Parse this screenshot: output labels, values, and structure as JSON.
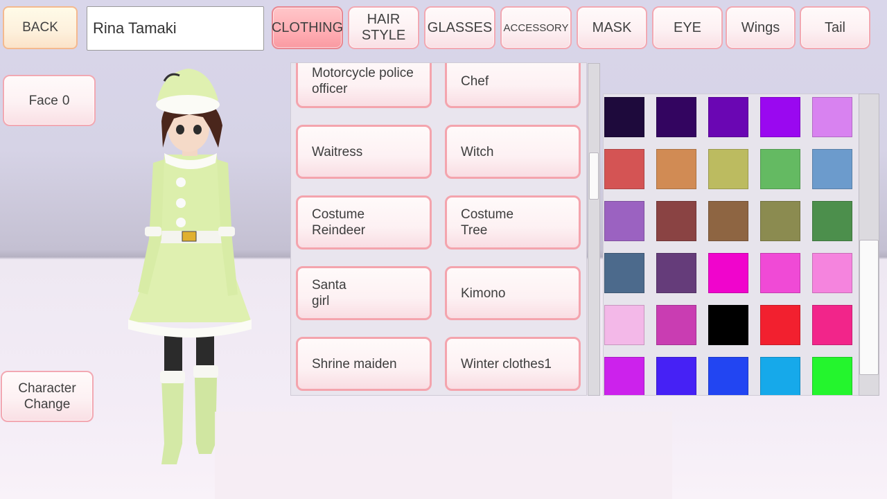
{
  "back_label": "BACK",
  "name_value": "Rina Tamaki",
  "tabs": [
    {
      "label": "CLOTHING",
      "active": true
    },
    {
      "label": "HAIR\nSTYLE",
      "active": false
    },
    {
      "label": "GLASSES",
      "active": false
    },
    {
      "label": "ACCESSORY",
      "active": false
    },
    {
      "label": "MASK",
      "active": false
    },
    {
      "label": "EYE",
      "active": false
    },
    {
      "label": "Wings",
      "active": false
    },
    {
      "label": "Tail",
      "active": false
    }
  ],
  "face_label": "Face",
  "face_value": "0",
  "character_change_label": "Character\nChange",
  "clothing_items": [
    "Motorcycle police\nofficer",
    "Chef",
    "Waitress",
    "Witch",
    "Costume\nReindeer",
    "Costume\nTree",
    "Santa\ngirl",
    "Kimono",
    "Shrine maiden",
    "Winter clothes1"
  ],
  "colors": [
    "#1e0a3c",
    "#330560",
    "#6a06b3",
    "#9a08f0",
    "#d882f0",
    "#d45454",
    "#d18b54",
    "#bcbb60",
    "#64ba62",
    "#6c9bcc",
    "#9b62c1",
    "#8a4343",
    "#8e6542",
    "#8b8b50",
    "#4c8f4c",
    "#4c6a8c",
    "#653c7a",
    "#f005cc",
    "#f04ad6",
    "#f584de",
    "#f3b8e8",
    "#c93db2",
    "#000000",
    "#f2202f",
    "#f2258a",
    "#cc22ec",
    "#4621f5",
    "#2245f2",
    "#16a9ea",
    "#24f52d"
  ]
}
